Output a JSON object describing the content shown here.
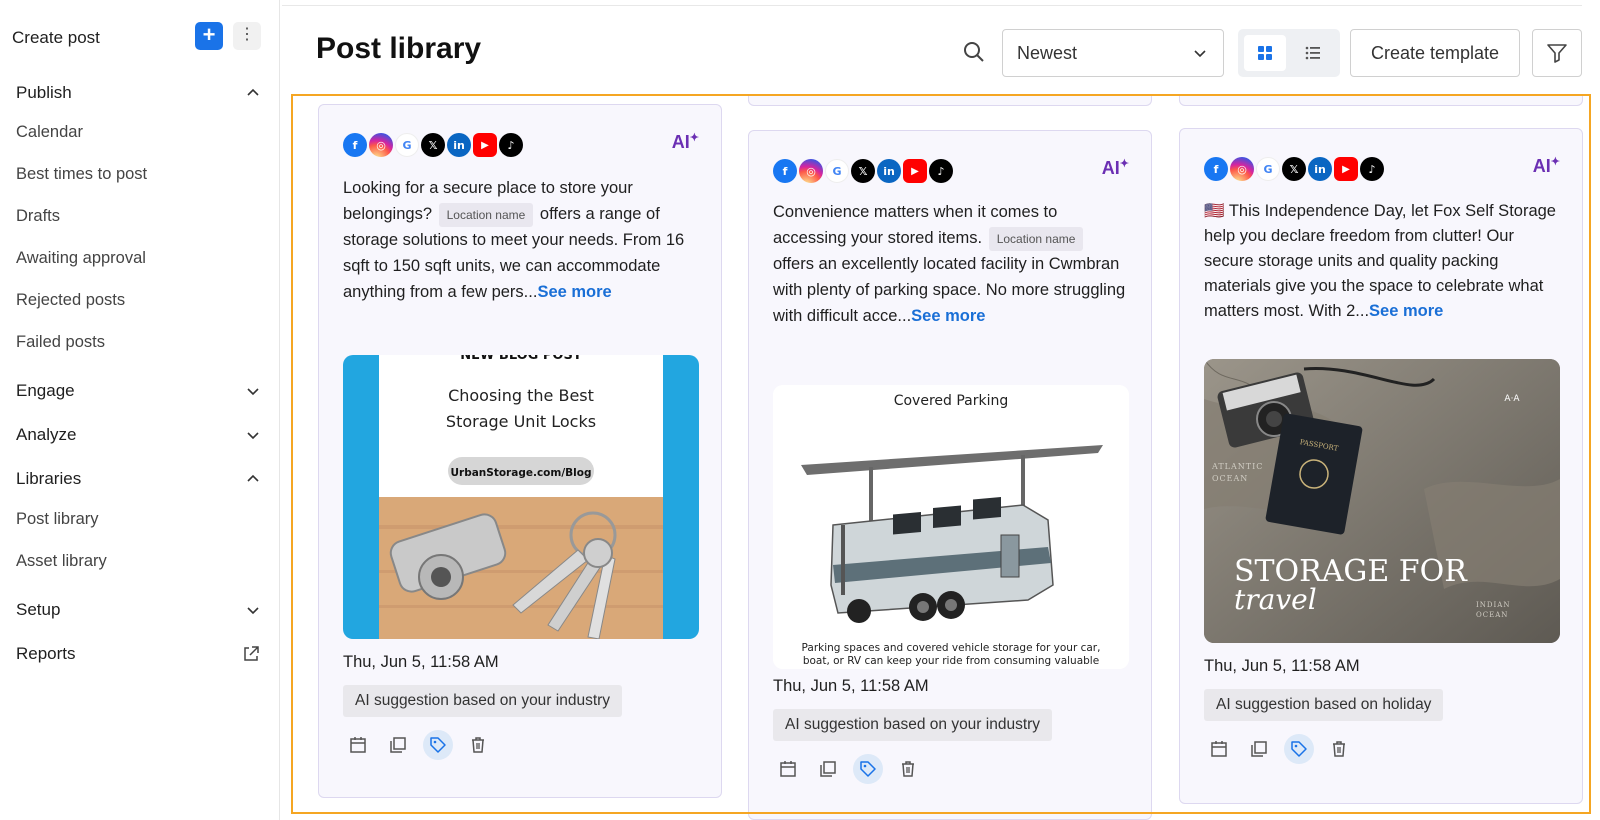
{
  "sidebar": {
    "create_post": "Create post",
    "plus_glyph": "+",
    "more_glyph": "⋮",
    "sections": {
      "publish": {
        "label": "Publish",
        "items": [
          "Calendar",
          "Best times to post",
          "Drafts",
          "Awaiting approval",
          "Rejected posts",
          "Failed posts"
        ]
      },
      "engage": {
        "label": "Engage"
      },
      "analyze": {
        "label": "Analyze"
      },
      "libraries": {
        "label": "Libraries",
        "items": [
          "Post library",
          "Asset library"
        ]
      },
      "setup": {
        "label": "Setup"
      },
      "reports": {
        "label": "Reports"
      }
    }
  },
  "header": {
    "title": "Post library",
    "sort_value": "Newest",
    "create_template": "Create template"
  },
  "social_icons": [
    {
      "name": "facebook",
      "glyph": "f",
      "color": "#1877f2"
    },
    {
      "name": "instagram",
      "glyph": "◎",
      "color": "#d62976"
    },
    {
      "name": "google",
      "glyph": "G",
      "color": "#ffffff"
    },
    {
      "name": "x",
      "glyph": "𝕏",
      "color": "#000000"
    },
    {
      "name": "linkedin",
      "glyph": "in",
      "color": "#0a66c2"
    },
    {
      "name": "youtube",
      "glyph": "▶",
      "color": "#ff0000"
    },
    {
      "name": "tiktok",
      "glyph": "♪",
      "color": "#000000"
    }
  ],
  "ai_label": "AI",
  "posts": [
    {
      "text_before": "Looking for a secure place to store your belongings?",
      "location_chip": "Location name",
      "text_after": "offers a range of storage solutions to meet your needs. From 16 sqft to 150 sqft units, we can accommodate anything from a few pers...",
      "see_more": "See more",
      "image": {
        "banner_top": "NEW BLOG POST",
        "heading_line1": "Choosing the Best",
        "heading_line2": "Storage Unit Locks",
        "url": "UrbanStorage.com/Blog"
      },
      "date": "Thu, Jun 5, 11:58 AM",
      "ai_suggestion": "AI suggestion based on your industry"
    },
    {
      "text_before": "Convenience matters when it comes to accessing your stored items.",
      "location_chip": "Location name",
      "text_after": "offers an excellently located facility in Cwmbran with plenty of parking space. No more struggling with difficult acce...",
      "see_more": "See more",
      "image": {
        "title": "Covered Parking",
        "caption_line1": "Parking spaces and covered vehicle storage for your car,",
        "caption_line2": "boat, or RV can keep your ride from consuming valuable"
      },
      "date": "Thu, Jun 5, 11:58 AM",
      "ai_suggestion": "AI suggestion based on your industry"
    },
    {
      "flag": "🇺🇸",
      "text": "This Independence Day, let Fox Self Storage help you declare freedom from clutter! Our secure storage units and quality packing materials give you the space to celebrate what matters most. With 2...",
      "see_more": "See more",
      "image": {
        "line1": "STORAGE FOR",
        "line2": "travel",
        "passport": "PASSPORT",
        "map_label1": "ATLANTIC",
        "map_label2": "OCEAN",
        "map_label3": "INDIAN",
        "map_label4": "OCEAN",
        "logo": "A·A"
      },
      "date": "Thu, Jun 5, 11:58 AM",
      "ai_suggestion": "AI suggestion based on holiday"
    }
  ]
}
